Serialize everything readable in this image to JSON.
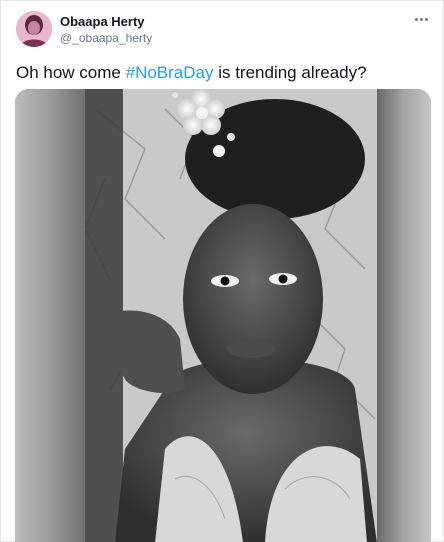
{
  "user": {
    "display_name": "Obaapa Herty",
    "handle": "@_obaapa_herty"
  },
  "tweet": {
    "text_before": "Oh how come ",
    "hashtag": "#NoBraDay",
    "text_after": " is trending already?"
  },
  "icons": {
    "more": "more-horizontal-icon",
    "avatar": "avatar-photo"
  },
  "colors": {
    "hashtag": "#1da1f2",
    "handle": "#657786",
    "name": "#14171a"
  }
}
